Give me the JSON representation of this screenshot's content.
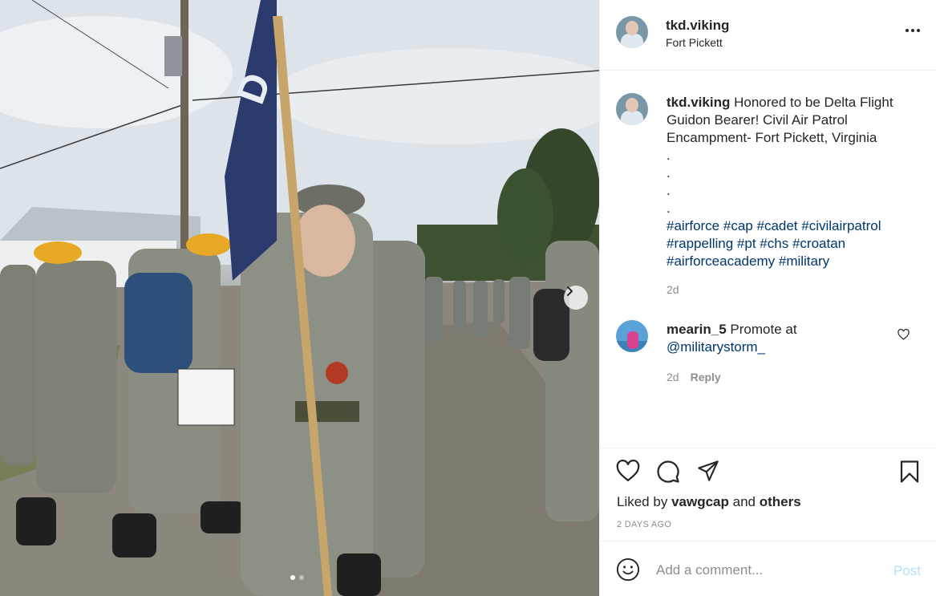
{
  "post": {
    "username": "tkd.viking",
    "location": "Fort Pickett"
  },
  "caption": {
    "username": "tkd.viking",
    "text": "Honored to be Delta Flight Guidon Bearer! Civil Air Patrol Encampment- Fort Pickett, Virginia",
    "dot_lines": [
      ".",
      ".",
      ".",
      "."
    ],
    "hashtags": [
      "#airforce",
      "#cap",
      "#cadet",
      "#civilairpatrol",
      "#rappelling",
      "#pt",
      "#chs",
      "#croatan",
      "#airforceacademy",
      "#military"
    ],
    "time": "2d"
  },
  "comment": {
    "username": "mearin_5",
    "text": "Promote at",
    "mention": "@militarystorm_",
    "time": "2d",
    "reply_label": "Reply"
  },
  "likes": {
    "prefix": "Liked by",
    "user": "vawgcap",
    "conjunction": "and",
    "others": "others"
  },
  "post_time": "2 DAYS AGO",
  "comment_box": {
    "placeholder": "Add a comment...",
    "post_label": "Post"
  },
  "carousel": {
    "slide_count": 2,
    "active_index": 0
  },
  "icons": [
    "more-options-icon",
    "heart-icon",
    "comment-icon",
    "share-icon",
    "save-icon",
    "emoji-icon",
    "chevron-right-icon"
  ],
  "colors": {
    "link": "#00376b",
    "post_button_disabled": "#b2dffc",
    "secondary_text": "#8e8e8e"
  }
}
